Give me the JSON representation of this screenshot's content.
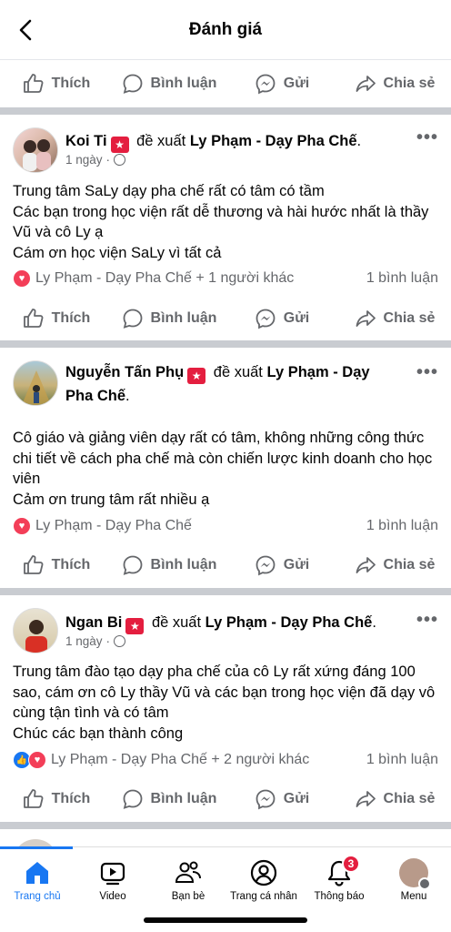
{
  "header": {
    "title": "Đánh giá"
  },
  "actions": {
    "like": "Thích",
    "comment": "Bình luận",
    "send": "Gửi",
    "share": "Chia sẻ"
  },
  "posts": [
    {
      "author": "Koi Ti",
      "recommends": "đề xuất",
      "page": "Ly Phạm - Dạy Pha Chế",
      "time": "1 ngày",
      "text": "Trung tâm SaLy dạy pha chế rất có tâm có tầm\nCác bạn trong học viện rất dễ thương và hài hước nhất là thầy Vũ và cô Ly ạ\nCám ơn học viện SaLy vì tất cả",
      "reactions": "Ly Phạm - Dạy Pha Chế + 1 người khác",
      "comments": "1 bình luận"
    },
    {
      "author": "Nguyễn Tấn Phụ",
      "recommends": "đề xuất",
      "page": "Ly Phạm - Dạy Pha Chế",
      "time": "",
      "text": "Cô giáo và giảng viên dạy rất có tâm, không những công thức chi tiết về cách pha chế mà còn chiến lược kinh doanh cho học viên\nCảm ơn trung tâm rất nhiều ạ",
      "reactions": "Ly Phạm - Dạy Pha Chế",
      "comments": "1 bình luận"
    },
    {
      "author": "Ngan Bi",
      "recommends": "đề xuất",
      "page": "Ly Phạm - Dạy Pha Chế",
      "time": "1 ngày",
      "text": "Trung tâm đào tạo dạy pha chế của cô Ly rất xứng đáng 100 sao, cám ơn cô Ly thầy Vũ và các bạn trong học viện đã dạy vô cùng tận tình và có tâm\nChúc các bạn thành công",
      "reactions": "Ly Phạm - Dạy Pha Chế + 2 người khác",
      "comments": "1 bình luận"
    }
  ],
  "tabs": [
    {
      "label": "Trang chủ",
      "icon": "home-icon"
    },
    {
      "label": "Video",
      "icon": "video-icon"
    },
    {
      "label": "Bạn bè",
      "icon": "friends-icon"
    },
    {
      "label": "Trang cá nhân",
      "icon": "profile-icon"
    },
    {
      "label": "Thông báo",
      "icon": "bell-icon",
      "badge": "3"
    },
    {
      "label": "Menu",
      "icon": "menu-avatar-icon"
    }
  ],
  "colors": {
    "accent": "#1877f2",
    "heart": "#f33e58",
    "recommend": "#e41e3f"
  }
}
